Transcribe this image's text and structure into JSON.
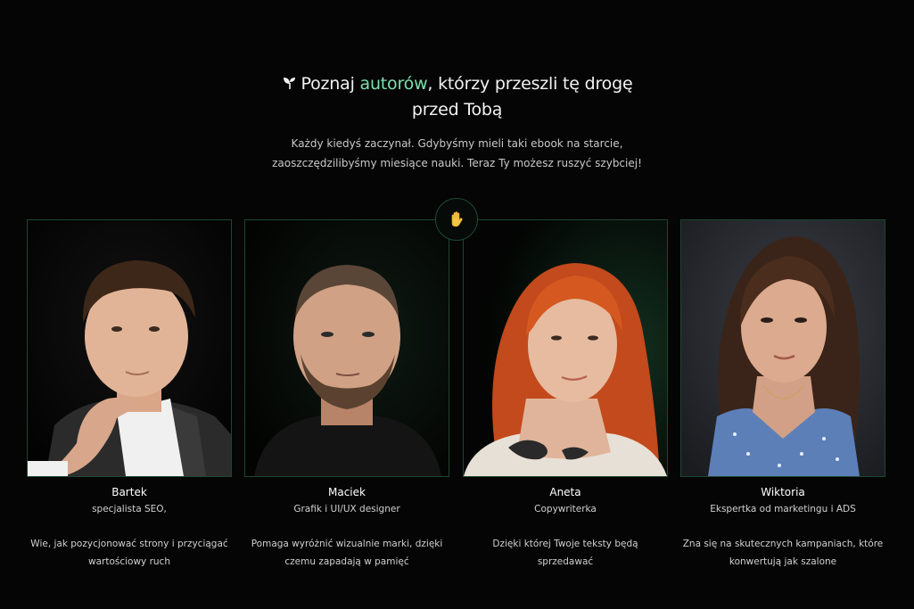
{
  "header": {
    "icon": "seedling-icon",
    "title_prefix": "Poznaj ",
    "title_accent": "autorów",
    "title_suffix": ", którzy przeszli tę drogę",
    "title_line2": "przed Tobą",
    "accent_color": "#7ee0ac"
  },
  "subtitle": {
    "line1": "Każdy kiedyś zaczynał. Gdybyśmy mieli taki ebook na starcie,",
    "line2": "zaoszczędzilibyśmy miesiące nauki. Teraz Ty możesz ruszyć szybciej!"
  },
  "badge": {
    "icon": "waving-hand-icon"
  },
  "authors": [
    {
      "name": "Bartek",
      "role": "specjalista SEO,",
      "desc_line1": "Wie, jak pozycjonować strony i przyciągać",
      "desc_line2": "wartościowy ruch"
    },
    {
      "name": "Maciek",
      "role": "Grafik i UI/UX designer",
      "desc_line1": "Pomaga wyróżnić wizualnie marki, dzięki",
      "desc_line2": "czemu zapadają w pamięć"
    },
    {
      "name": "Aneta",
      "role": "Copywriterka",
      "desc_line1": "Dzięki której Twoje teksty będą",
      "desc_line2": "sprzedawać"
    },
    {
      "name": "Wiktoria",
      "role": "Ekspertka od marketingu i ADS",
      "desc_line1": "Zna się na skutecznych kampaniach, które",
      "desc_line2": "konwertują jak szalone"
    }
  ]
}
